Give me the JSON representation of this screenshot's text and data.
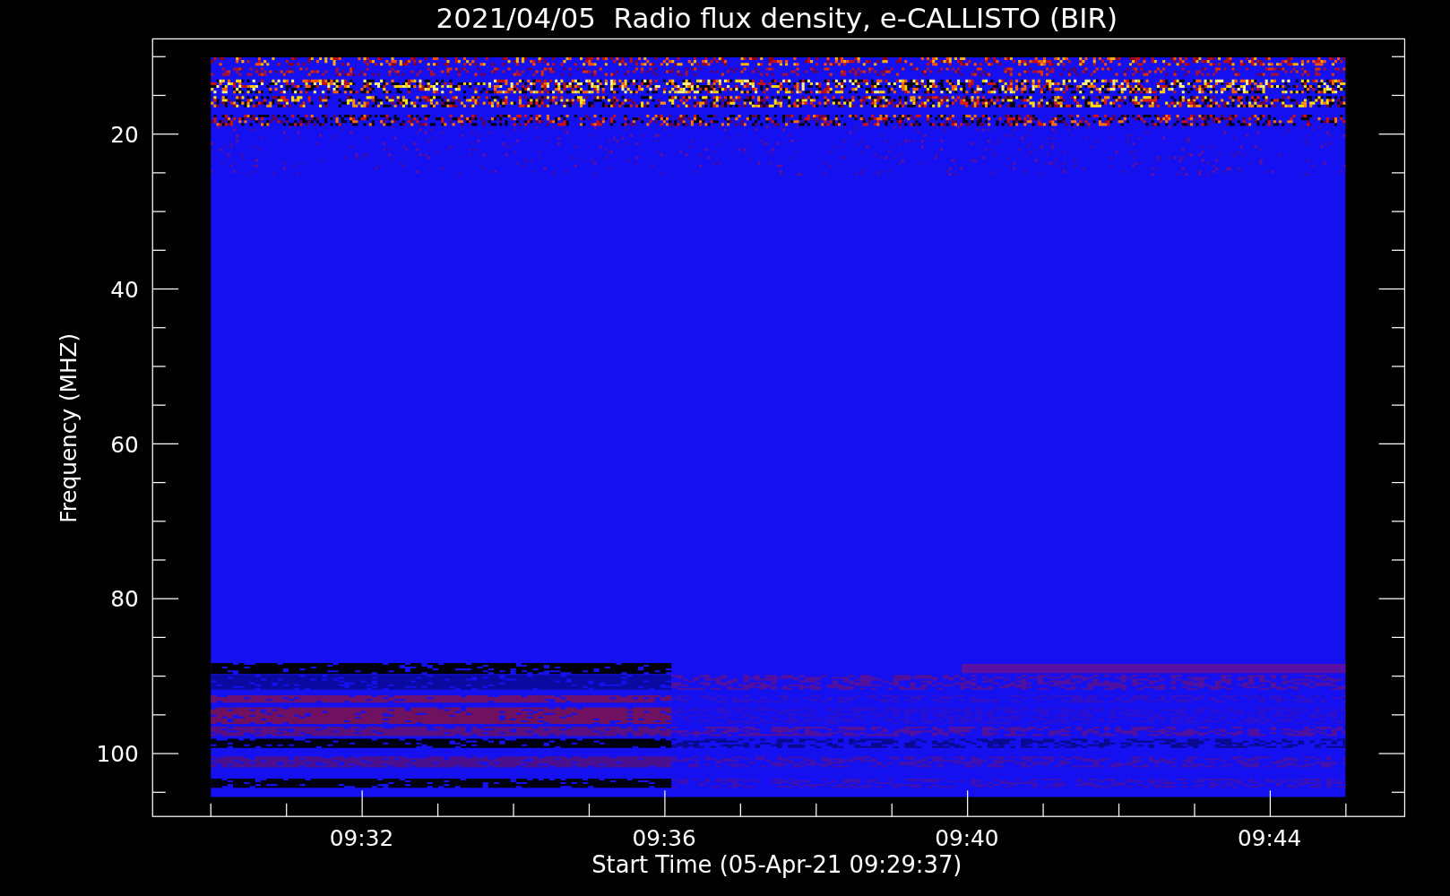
{
  "plot": {
    "title": "2021/04/05  Radio flux density, e-CALLISTO (BIR)",
    "xlabel": "Start Time (05-Apr-21 09:29:37)",
    "ylabel": "Frequency (MHZ)",
    "yticks": [
      "20",
      "40",
      "60",
      "80",
      "100"
    ],
    "xticks": [
      "09:32",
      "09:36",
      "09:40",
      "09:44"
    ]
  }
}
